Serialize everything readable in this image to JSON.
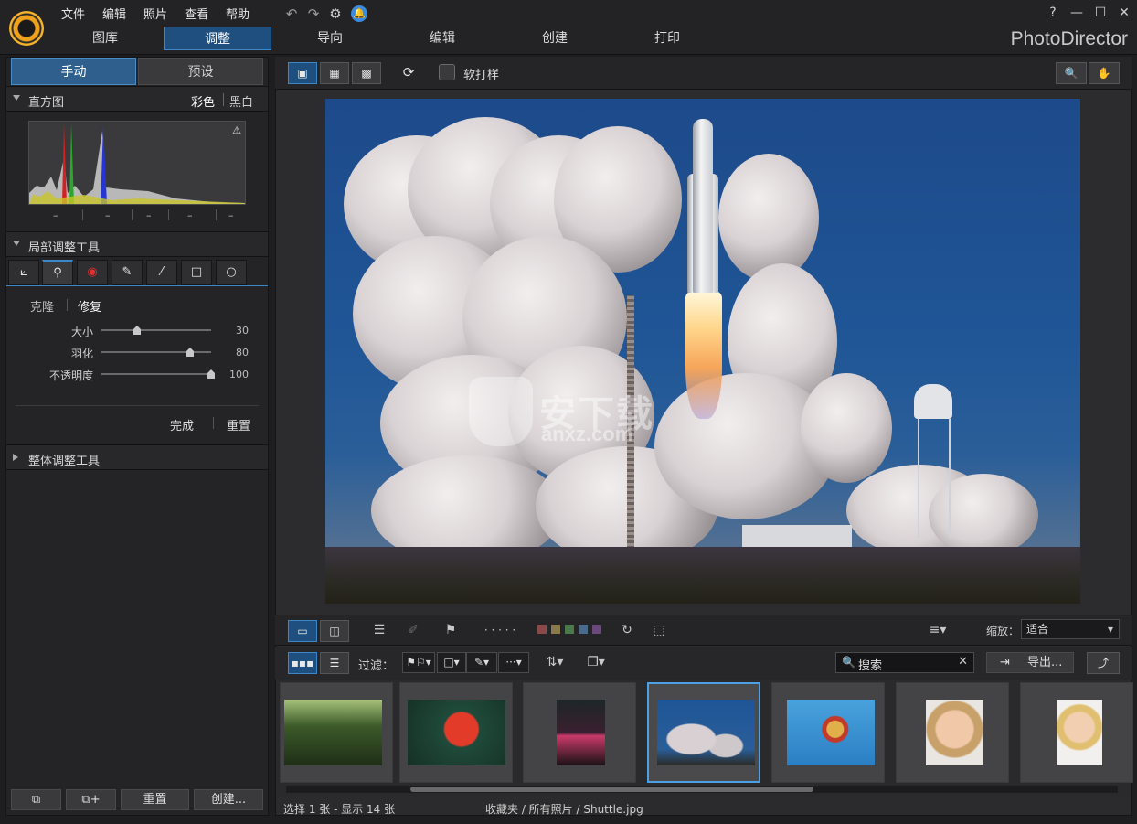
{
  "app": {
    "brand": "PhotoDirector",
    "menu": [
      "文件",
      "编辑",
      "照片",
      "查看",
      "帮助"
    ],
    "module_tabs": [
      "图库",
      "调整",
      "导向",
      "编辑",
      "创建",
      "打印"
    ],
    "active_module": "调整",
    "window_controls": [
      "?",
      "—",
      "☐",
      "✕"
    ]
  },
  "left_panel": {
    "tabs": [
      "手动",
      "预设"
    ],
    "histogram": {
      "title": "直方图",
      "mode_color": "彩色",
      "mode_bw": "黑白",
      "ticks": [
        "–",
        "–",
        "–",
        "–",
        "–"
      ]
    },
    "local_tools": {
      "title": "局部调整工具",
      "tool_icons": [
        "crop-icon",
        "spot-removal-icon",
        "red-eye-icon",
        "brush-icon",
        "gradient-mask-icon",
        "rectangle-icon",
        "circle-icon"
      ],
      "subtabs": [
        "克隆",
        "修复"
      ],
      "sliders": [
        {
          "label": "大小",
          "value": "30",
          "level": 0.3
        },
        {
          "label": "羽化",
          "value": "80",
          "level": 0.8
        },
        {
          "label": "不透明度",
          "value": "100",
          "level": 1.0
        }
      ],
      "done": "完成",
      "reset": "重置"
    },
    "global_tools": {
      "title": "整体调整工具"
    },
    "bottom_buttons": [
      "重置",
      "创建..."
    ]
  },
  "viewer": {
    "softproof_label": "软打样",
    "watermark_text": "安下载",
    "watermark_url": "anxz.com"
  },
  "bottom_toolbar": {
    "zoom_label": "缩放：",
    "zoom_value": "适合",
    "rating_dots": "· · · · ·",
    "color_labels": [
      "#8a4a4a",
      "#8a7a4a",
      "#4a7a4a",
      "#4a6a8a",
      "#6a4a7a"
    ]
  },
  "filter_bar": {
    "label": "过滤：",
    "search_placeholder": "搜索",
    "export_label": "导出..."
  },
  "status": {
    "selection": "选择 1 张 - 显示 14 张",
    "path": "收藏夹 / 所有照片 / Shuttle.jpg"
  },
  "colors": {
    "accent": "#3c87c8",
    "active_tab": "#1f4f7e",
    "selected_thumb": "#4ea0e6"
  }
}
